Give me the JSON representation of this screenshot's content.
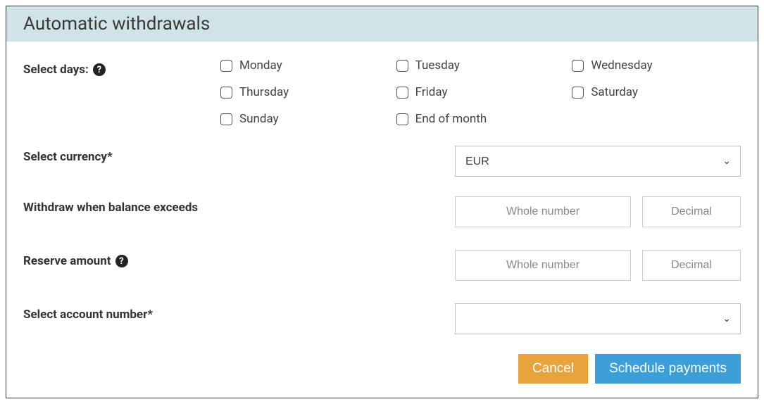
{
  "header": {
    "title": "Automatic withdrawals"
  },
  "labels": {
    "select_days": "Select days:",
    "select_currency": "Select currency*",
    "withdraw_when": "Withdraw when balance exceeds",
    "reserve_amount": "Reserve amount",
    "select_account": "Select account number*"
  },
  "days": {
    "monday": "Monday",
    "tuesday": "Tuesday",
    "wednesday": "Wednesday",
    "thursday": "Thursday",
    "friday": "Friday",
    "saturday": "Saturday",
    "sunday": "Sunday",
    "end_of_month": "End of month"
  },
  "currency": {
    "selected": "EUR"
  },
  "placeholders": {
    "whole": "Whole number",
    "decimal": "Decimal"
  },
  "account": {
    "selected": ""
  },
  "buttons": {
    "cancel": "Cancel",
    "schedule": "Schedule payments"
  },
  "icons": {
    "help": "?"
  }
}
